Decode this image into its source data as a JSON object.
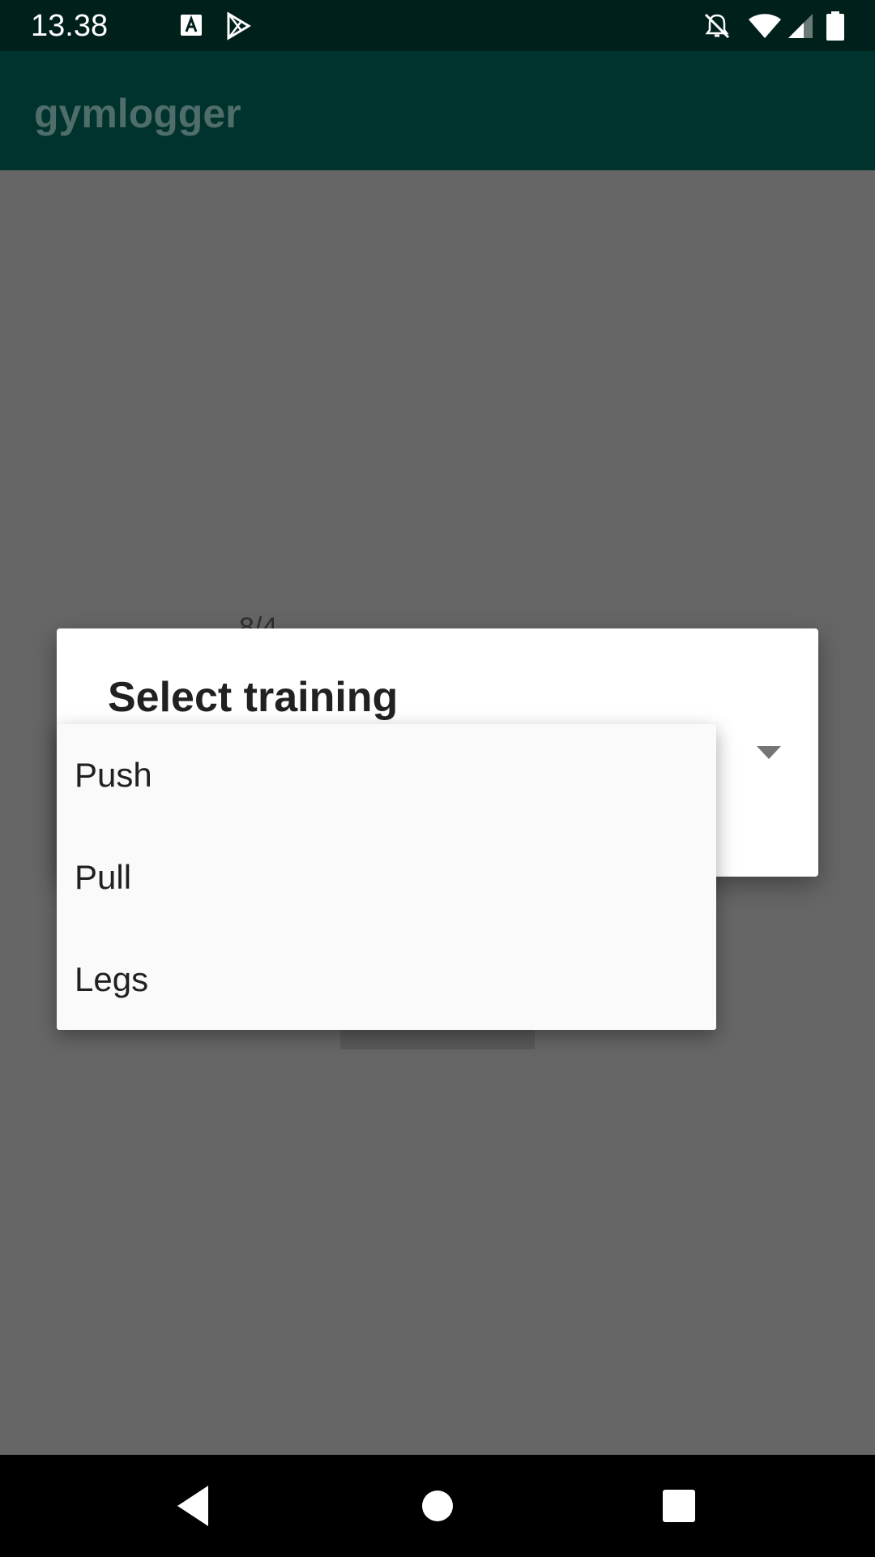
{
  "status_bar": {
    "time": "13.38",
    "icons": [
      "keyboard-a-icon",
      "play-store-icon",
      "notifications-off-icon",
      "wifi-icon",
      "signal-icon",
      "battery-icon"
    ]
  },
  "app_bar": {
    "title": "gymlogger"
  },
  "background": {
    "partial_text": "8/4"
  },
  "dialog": {
    "title": "Select training",
    "spinner_icon": "dropdown-arrow-icon"
  },
  "dropdown": {
    "items": [
      {
        "label": "Push"
      },
      {
        "label": "Pull"
      },
      {
        "label": "Legs"
      }
    ]
  },
  "nav_bar": {
    "icons": [
      "back-icon",
      "home-icon",
      "recents-icon"
    ]
  },
  "colors": {
    "status_bar": "#00201c",
    "app_bar": "#00332e",
    "scrim": "#666666",
    "dialog": "#ffffff",
    "dropdown": "#fafafa"
  }
}
